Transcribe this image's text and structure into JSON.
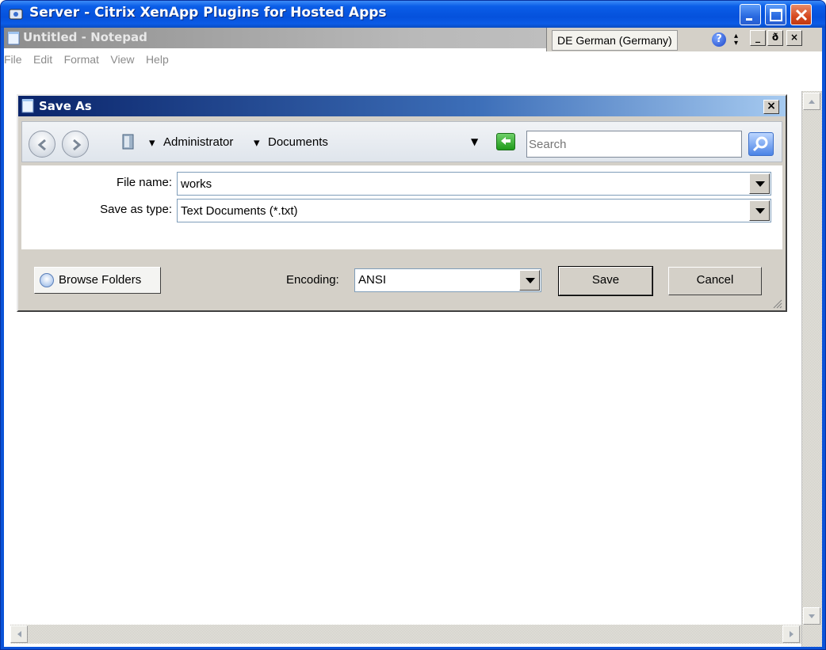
{
  "outer_window": {
    "title": "Server - Citrix XenApp Plugins for Hosted Apps"
  },
  "notepad": {
    "title": "Untitled - Notepad",
    "menu": [
      "File",
      "Edit",
      "Format",
      "View",
      "Help"
    ]
  },
  "language_bar": {
    "language": "DE German (Germany)"
  },
  "dialog": {
    "title": "Save As",
    "breadcrumb": [
      "Administrator",
      "Documents"
    ],
    "search_placeholder": "Search",
    "file_name_label": "File name:",
    "file_name_value": "works",
    "save_type_label": "Save as type:",
    "save_type_value": "Text Documents (*.txt)",
    "browse_folders_label": "Browse Folders",
    "encoding_label": "Encoding:",
    "encoding_value": "ANSI",
    "save_label": "Save",
    "cancel_label": "Cancel"
  },
  "colors": {
    "xp_title_blue": "#0551dc",
    "dialog_title_start": "#0a246a",
    "dialog_face": "#d4d0c8",
    "close_red": "#d6491f"
  }
}
